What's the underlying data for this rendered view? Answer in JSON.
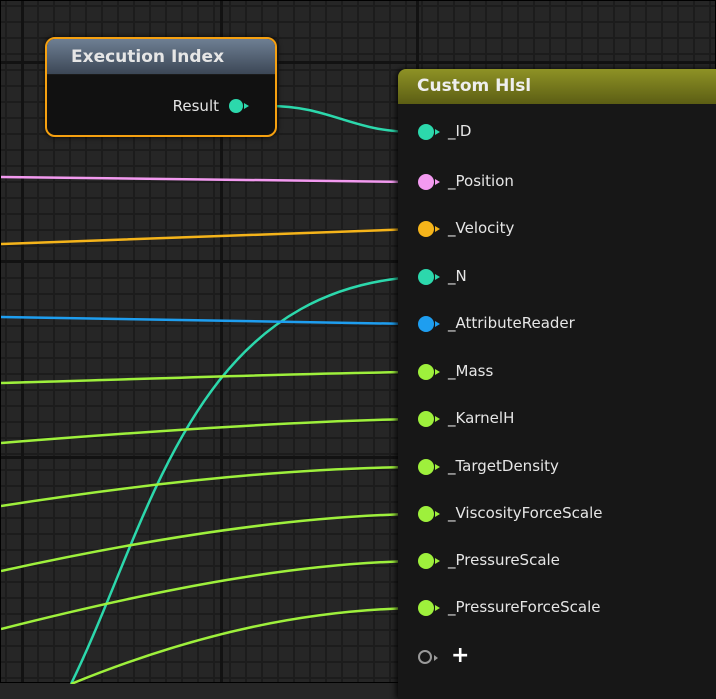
{
  "execution_index_node": {
    "title": "Execution Index",
    "output_label": "Result",
    "output_color": "#2cd8ac"
  },
  "custom_hlsl_node": {
    "title": "Custom Hlsl",
    "inputs": [
      {
        "label": "_ID",
        "color": "#2cd8ac"
      },
      {
        "label": "_Position",
        "color": "#f39af0"
      },
      {
        "label": "_Velocity",
        "color": "#f5b41a"
      },
      {
        "label": "_N",
        "color": "#2cd8ac"
      },
      {
        "label": "_AttributeReader",
        "color": "#1e9ef0"
      },
      {
        "label": "_Mass",
        "color": "#9ef03c"
      },
      {
        "label": "_KarnelH",
        "color": "#9ef03c"
      },
      {
        "label": "_TargetDensity",
        "color": "#9ef03c"
      },
      {
        "label": "_ViscosityForceScale",
        "color": "#9ef03c"
      },
      {
        "label": "_PressureScale",
        "color": "#9ef03c"
      },
      {
        "label": "_PressureForceScale",
        "color": "#9ef03c"
      }
    ],
    "add_pin_label": "+"
  },
  "colors": {
    "int_pin": "#2cd8ac",
    "position_pin": "#f39af0",
    "vector_pin": "#f5b41a",
    "attribute_reader_pin": "#1e9ef0",
    "float_pin": "#9ef03c",
    "selected_node_border": "#f5a010"
  }
}
